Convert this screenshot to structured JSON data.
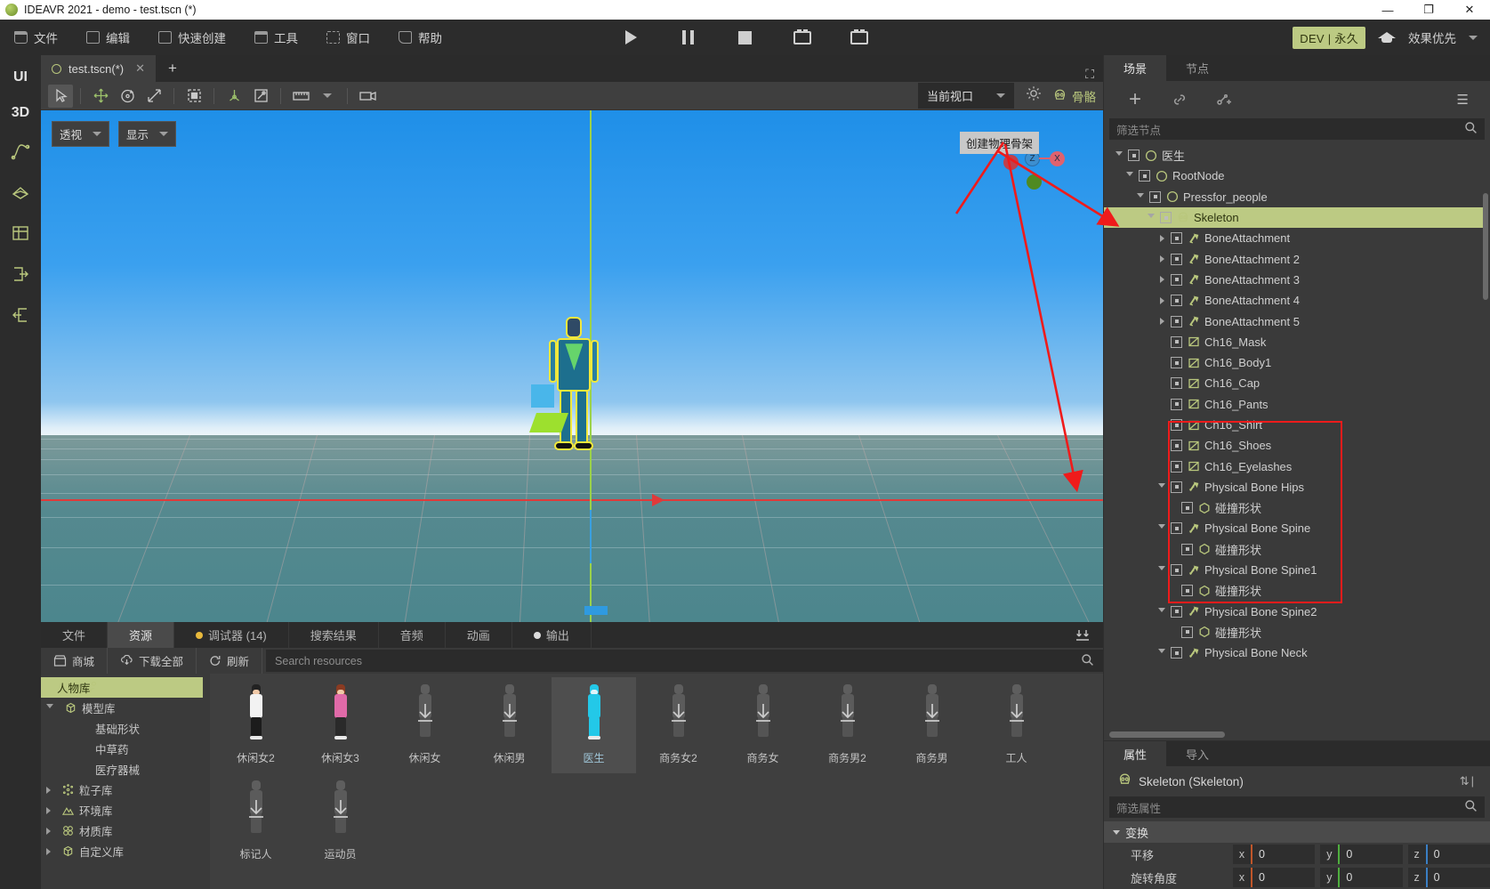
{
  "window": {
    "title": "IDEAVR 2021 - demo - test.tscn (*)",
    "minimize": "—",
    "maximize": "❐",
    "close": "✕"
  },
  "menubar": {
    "items": [
      {
        "label": "文件",
        "icon": "folder-icon"
      },
      {
        "label": "编辑",
        "icon": "crop-icon"
      },
      {
        "label": "快速创建",
        "icon": "pen-icon"
      },
      {
        "label": "工具",
        "icon": "window-icon"
      },
      {
        "label": "窗口",
        "icon": "selection-icon"
      },
      {
        "label": "帮助",
        "icon": "book-icon"
      }
    ],
    "transport": [
      {
        "name": "play-button",
        "icon": "play-icon"
      },
      {
        "name": "pause-button",
        "icon": "pause-icon"
      },
      {
        "name": "stop-button",
        "icon": "stop-icon"
      },
      {
        "name": "play-scene-button",
        "icon": "movie-icon"
      },
      {
        "name": "play-custom-scene-button",
        "icon": "movie-alt-icon"
      }
    ],
    "dev_badge": "DEV | 永久",
    "academy_icon": "graduation-cap-icon",
    "quality": "效果优先"
  },
  "rail": {
    "ui_label": "UI",
    "d3_label": "3D",
    "items": [
      {
        "name": "rail-animation",
        "icon": "curve-icon"
      },
      {
        "name": "rail-mesh",
        "icon": "mesh-icon"
      },
      {
        "name": "rail-scene",
        "icon": "cube-grid-icon"
      },
      {
        "name": "rail-export",
        "icon": "export-icon"
      },
      {
        "name": "rail-import",
        "icon": "import-icon"
      }
    ]
  },
  "scene_tab": {
    "label": "test.tscn(*)",
    "close": "✕",
    "add": "+",
    "expand_icon": "expand-icon"
  },
  "viewport_toolbar": {
    "tools": [
      {
        "name": "select-tool",
        "icon": "cursor-icon",
        "active": true
      },
      {
        "name": "move-tool",
        "icon": "move-icon"
      },
      {
        "name": "rotate-tool",
        "icon": "rotate-icon"
      },
      {
        "name": "scale-tool",
        "icon": "scale-icon"
      },
      {
        "name": "local-space-tool",
        "icon": "local-space-icon"
      },
      {
        "name": "snap-origin-tool",
        "icon": "snap-origin-icon"
      },
      {
        "name": "lock-tool",
        "icon": "lock-transform-icon"
      },
      {
        "name": "ruler-tool",
        "icon": "ruler-icon"
      },
      {
        "name": "camera-tool",
        "icon": "camera-icon"
      }
    ],
    "viewport_select": "当前视口",
    "settings_icon": "gear-icon",
    "bone_button": "骨骼",
    "tooltip": "创建物理骨架"
  },
  "viewport_overlays": {
    "perspective": "透视",
    "display": "显示",
    "gizmo_axes": [
      "X",
      "Z"
    ]
  },
  "dock": {
    "tabs": [
      {
        "label": "文件",
        "active": false,
        "dot": null
      },
      {
        "label": "资源",
        "active": true,
        "dot": null
      },
      {
        "label": "调试器 (14)",
        "active": false,
        "dot": "yellow"
      },
      {
        "label": "搜索结果",
        "active": false,
        "dot": null
      },
      {
        "label": "音频",
        "active": false,
        "dot": null
      },
      {
        "label": "动画",
        "active": false,
        "dot": null
      },
      {
        "label": "输出",
        "active": false,
        "dot": "white"
      }
    ],
    "collapse_icon": "collapse-down-icon",
    "toolbar": {
      "store": "商城",
      "download_all": "下载全部",
      "refresh": "刷新",
      "search_placeholder": "Search resources",
      "search_icon": "search-icon"
    },
    "categories": [
      {
        "label": "人物库",
        "icon": "person-icon",
        "selected": true,
        "arrow": null,
        "indent": 1
      },
      {
        "label": "模型库",
        "icon": "cube-icon",
        "selected": false,
        "arrow": "down",
        "indent": 0
      },
      {
        "label": "基础形状",
        "icon": null,
        "selected": false,
        "arrow": null,
        "indent": 2
      },
      {
        "label": "中草药",
        "icon": null,
        "selected": false,
        "arrow": null,
        "indent": 2
      },
      {
        "label": "医疗器械",
        "icon": null,
        "selected": false,
        "arrow": null,
        "indent": 2
      },
      {
        "label": "粒子库",
        "icon": "particles-icon",
        "selected": false,
        "arrow": "right",
        "indent": 0
      },
      {
        "label": "环境库",
        "icon": "mountain-icon",
        "selected": false,
        "arrow": "right",
        "indent": 0
      },
      {
        "label": "材质库",
        "icon": "spheres-icon",
        "selected": false,
        "arrow": "right",
        "indent": 0
      },
      {
        "label": "自定义库",
        "icon": "cube-icon",
        "selected": false,
        "arrow": "right",
        "indent": 0
      }
    ],
    "assets": [
      {
        "label": "休闲女2",
        "state": "downloaded",
        "selected": false
      },
      {
        "label": "休闲女3",
        "state": "downloaded",
        "selected": false
      },
      {
        "label": "休闲女",
        "state": "not-downloaded",
        "selected": false
      },
      {
        "label": "休闲男",
        "state": "not-downloaded",
        "selected": false
      },
      {
        "label": "医生",
        "state": "downloaded",
        "selected": true
      },
      {
        "label": "商务女2",
        "state": "not-downloaded",
        "selected": false
      },
      {
        "label": "商务女",
        "state": "not-downloaded",
        "selected": false
      },
      {
        "label": "商务男2",
        "state": "not-downloaded",
        "selected": false
      },
      {
        "label": "商务男",
        "state": "not-downloaded",
        "selected": false
      },
      {
        "label": "工人",
        "state": "not-downloaded",
        "selected": false
      },
      {
        "label": "标记人",
        "state": "not-downloaded",
        "selected": false
      },
      {
        "label": "运动员",
        "state": "not-downloaded",
        "selected": false
      }
    ]
  },
  "right_panel": {
    "tabs": [
      {
        "label": "场景",
        "active": true
      },
      {
        "label": "节点",
        "active": false
      }
    ],
    "menu_icon": "hamburger-icon",
    "tools": [
      {
        "name": "add-node-button",
        "icon": "plus-icon"
      },
      {
        "name": "instance-scene-button",
        "icon": "link-icon"
      },
      {
        "name": "add-child-scene-button",
        "icon": "node-add-icon"
      }
    ],
    "filter_placeholder": "筛选节点",
    "filter_search_icon": "search-icon",
    "tree": [
      {
        "label": "医生",
        "indent": 0,
        "arrow": "open",
        "icon": "spatial-icon",
        "selected": false
      },
      {
        "label": "RootNode",
        "indent": 1,
        "arrow": "open",
        "icon": "spatial-icon",
        "selected": false
      },
      {
        "label": "Pressfor_people",
        "indent": 2,
        "arrow": "open",
        "icon": "spatial-icon",
        "selected": false
      },
      {
        "label": "Skeleton",
        "indent": 3,
        "arrow": "open",
        "icon": "skeleton-icon",
        "selected": true
      },
      {
        "label": "BoneAttachment",
        "indent": 4,
        "arrow": "closed",
        "icon": "bone-attachment-icon",
        "selected": false
      },
      {
        "label": "BoneAttachment 2",
        "indent": 4,
        "arrow": "closed",
        "icon": "bone-attachment-icon",
        "selected": false
      },
      {
        "label": "BoneAttachment 3",
        "indent": 4,
        "arrow": "closed",
        "icon": "bone-attachment-icon",
        "selected": false
      },
      {
        "label": "BoneAttachment 4",
        "indent": 4,
        "arrow": "closed",
        "icon": "bone-attachment-icon",
        "selected": false
      },
      {
        "label": "BoneAttachment 5",
        "indent": 4,
        "arrow": "closed",
        "icon": "bone-attachment-icon",
        "selected": false
      },
      {
        "label": "Ch16_Mask",
        "indent": 4,
        "arrow": null,
        "icon": "mesh-instance-icon",
        "selected": false
      },
      {
        "label": "Ch16_Body1",
        "indent": 4,
        "arrow": null,
        "icon": "mesh-instance-icon",
        "selected": false
      },
      {
        "label": "Ch16_Cap",
        "indent": 4,
        "arrow": null,
        "icon": "mesh-instance-icon",
        "selected": false
      },
      {
        "label": "Ch16_Pants",
        "indent": 4,
        "arrow": null,
        "icon": "mesh-instance-icon",
        "selected": false
      },
      {
        "label": "Ch16_Shirt",
        "indent": 4,
        "arrow": null,
        "icon": "mesh-instance-icon",
        "selected": false
      },
      {
        "label": "Ch16_Shoes",
        "indent": 4,
        "arrow": null,
        "icon": "mesh-instance-icon",
        "selected": false
      },
      {
        "label": "Ch16_Eyelashes",
        "indent": 4,
        "arrow": null,
        "icon": "mesh-instance-icon",
        "selected": false
      },
      {
        "label": "Physical Bone Hips",
        "indent": 4,
        "arrow": "open",
        "icon": "physical-bone-icon",
        "selected": false
      },
      {
        "label": "碰撞形状",
        "indent": 5,
        "arrow": null,
        "icon": "collision-shape-icon",
        "selected": false
      },
      {
        "label": "Physical Bone Spine",
        "indent": 4,
        "arrow": "open",
        "icon": "physical-bone-icon",
        "selected": false
      },
      {
        "label": "碰撞形状",
        "indent": 5,
        "arrow": null,
        "icon": "collision-shape-icon",
        "selected": false
      },
      {
        "label": "Physical Bone Spine1",
        "indent": 4,
        "arrow": "open",
        "icon": "physical-bone-icon",
        "selected": false
      },
      {
        "label": "碰撞形状",
        "indent": 5,
        "arrow": null,
        "icon": "collision-shape-icon",
        "selected": false
      },
      {
        "label": "Physical Bone Spine2",
        "indent": 4,
        "arrow": "open",
        "icon": "physical-bone-icon",
        "selected": false
      },
      {
        "label": "碰撞形状",
        "indent": 5,
        "arrow": null,
        "icon": "collision-shape-icon",
        "selected": false
      },
      {
        "label": "Physical Bone Neck",
        "indent": 4,
        "arrow": "open",
        "icon": "physical-bone-icon",
        "selected": false
      }
    ]
  },
  "inspector": {
    "tabs": [
      {
        "label": "属性",
        "active": true
      },
      {
        "label": "导入",
        "active": false
      }
    ],
    "node_title": "Skeleton (Skeleton)",
    "node_icon": "skeleton-icon",
    "tools_icon": "inspector-tools-icon",
    "filter_placeholder": "筛选属性",
    "filter_search_icon": "search-icon",
    "section": "变换",
    "rows": [
      {
        "name": "平移",
        "axes": [
          {
            "axis": "x",
            "value": "0",
            "color": "#c0562a"
          },
          {
            "axis": "y",
            "value": "0",
            "color": "#4fae3f"
          },
          {
            "axis": "z",
            "value": "0",
            "color": "#3a7fc4"
          }
        ]
      },
      {
        "name": "旋转角度",
        "axes": [
          {
            "axis": "x",
            "value": "0",
            "color": "#c0562a"
          },
          {
            "axis": "y",
            "value": "0",
            "color": "#4fae3f"
          },
          {
            "axis": "z",
            "value": "0",
            "color": "#3a7fc4"
          }
        ]
      }
    ]
  },
  "colors": {
    "accent": "#bcca83",
    "annotation_red": "#ef1b1b",
    "panel_bg": "#3a3a3a",
    "dark_bg": "#2b2b2b"
  }
}
